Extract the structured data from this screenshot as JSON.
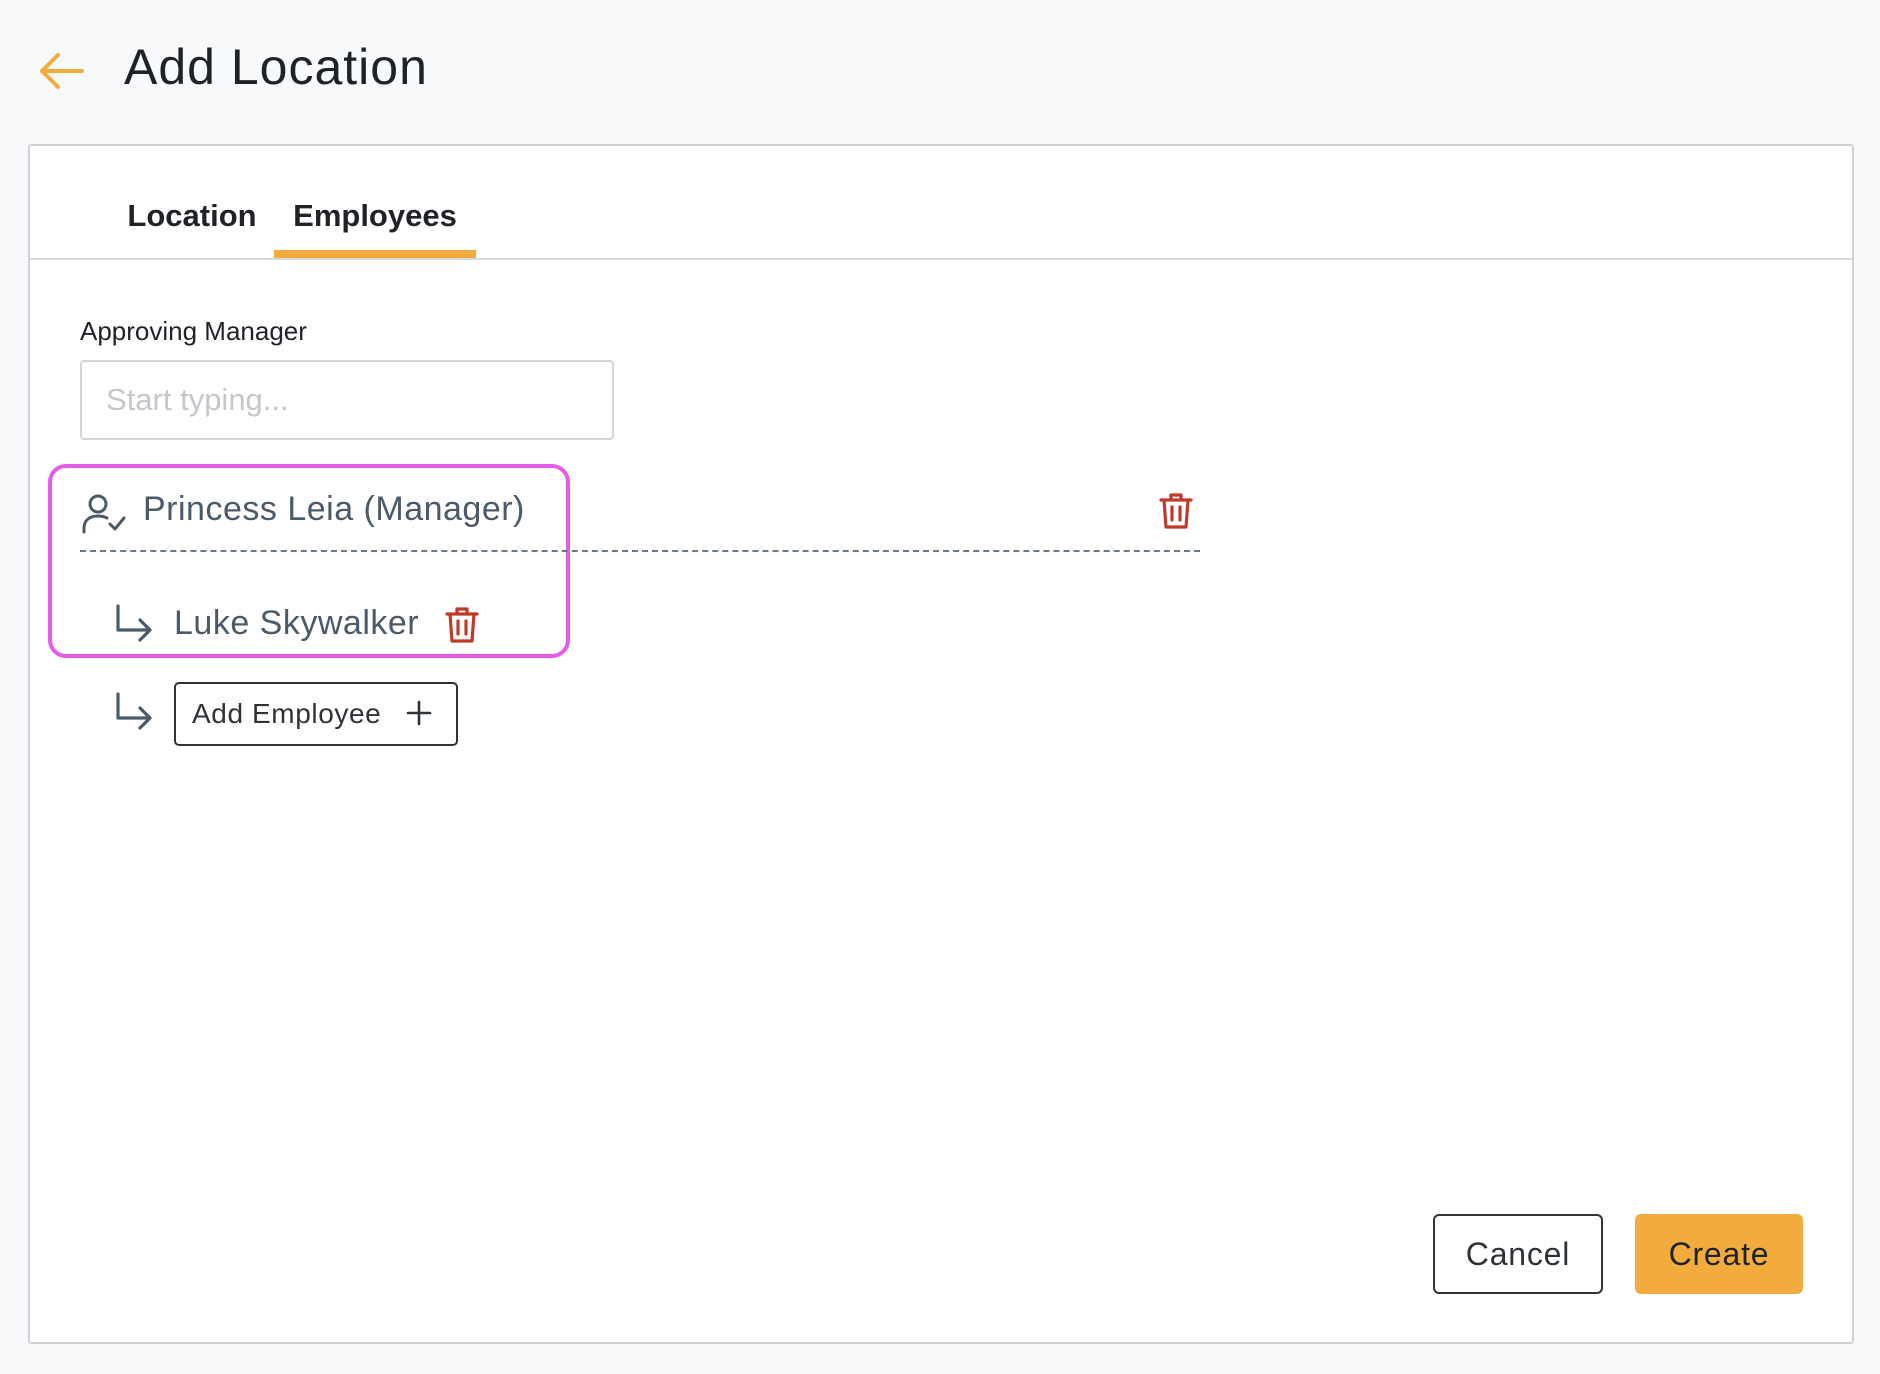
{
  "header": {
    "title": "Add Location",
    "back_icon": "arrow-left-icon"
  },
  "tabs": [
    {
      "label": "Location",
      "active": false
    },
    {
      "label": "Employees",
      "active": true
    }
  ],
  "approving_manager": {
    "label": "Approving Manager",
    "placeholder": "Start typing...",
    "value": ""
  },
  "manager": {
    "name": "Princess Leia (Manager)",
    "icon": "user-check-icon",
    "delete_icon": "trash-icon"
  },
  "employees": [
    {
      "name": "Luke Skywalker",
      "icon": "arrow-turn-down-right-icon",
      "delete_icon": "trash-icon"
    }
  ],
  "add_employee": {
    "label": "Add Employee",
    "icon": "plus-icon"
  },
  "actions": {
    "cancel_label": "Cancel",
    "create_label": "Create"
  },
  "colors": {
    "accent": "#f2ac3e",
    "danger": "#c0392b",
    "highlight": "#e55ce8",
    "muted_text": "#4b5a69"
  }
}
